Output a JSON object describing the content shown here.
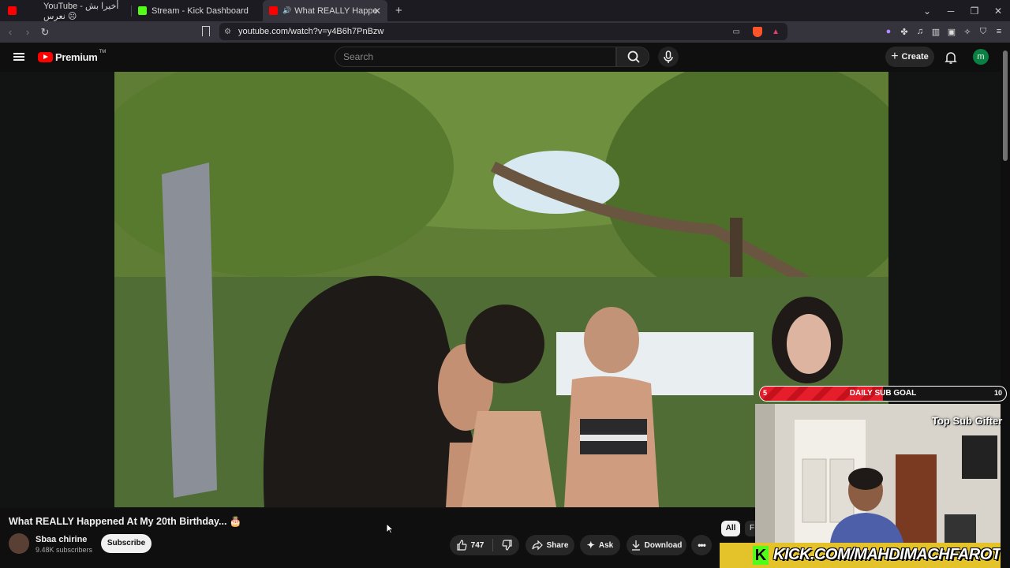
{
  "browser": {
    "tabs": [
      {
        "label": "YouTube - أخيرا بش نعرس ☹",
        "active": false
      },
      {
        "label": "Stream - Kick Dashboard",
        "active": false
      },
      {
        "label": "What REALLY Happened At M",
        "active": true
      }
    ],
    "url": "youtube.com/watch?v=y4B6h7PnBzw"
  },
  "youtube": {
    "logo_text": "Premium",
    "logo_tm": "TM",
    "search_placeholder": "Search",
    "create_label": "Create",
    "avatar_letter": "m"
  },
  "video": {
    "title": "What REALLY Happened At My 20th Birthday... 🎂",
    "channel_name": "Sbaa chirine",
    "channel_subs": "9.48K subscribers",
    "subscribe_label": "Subscribe",
    "likes": "747",
    "share_label": "Share",
    "ask_label": "Ask",
    "download_label": "Download"
  },
  "chips": {
    "all": "All",
    "next": "F"
  },
  "overlay": {
    "sub_goal_current": "5",
    "sub_goal_label": "DAILY SUB GOAL",
    "sub_goal_max": "10",
    "sub_goal_progress": 0.5,
    "top_gifter": "Top Sub Gifter",
    "kick_url": "KICK.COM/MAHDIMACHFAROTB"
  },
  "colors": {
    "yt_red": "#ff0000",
    "avatar_green": "#0b8043",
    "kick_green": "#53fc18",
    "goal_red": "#e61e2b"
  }
}
